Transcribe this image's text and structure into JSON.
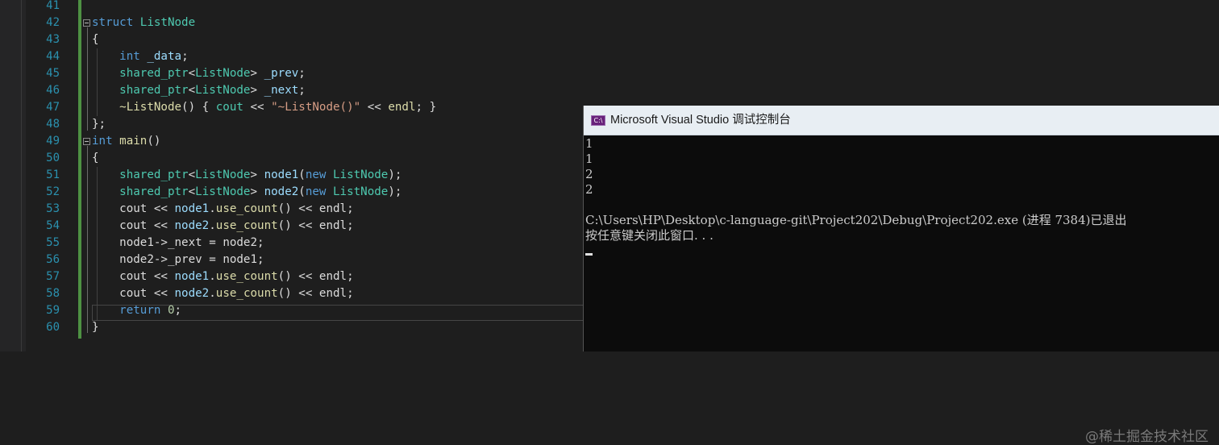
{
  "editor": {
    "line_numbers": [
      "41",
      "42",
      "43",
      "44",
      "45",
      "46",
      "47",
      "48",
      "49",
      "50",
      "51",
      "52",
      "53",
      "54",
      "55",
      "56",
      "57",
      "58",
      "59",
      "60"
    ],
    "lines": [
      {
        "indent": "",
        "tokens": []
      },
      {
        "indent": "",
        "tokens": [
          [
            "kw",
            "struct"
          ],
          [
            "pl",
            " "
          ],
          [
            "ty",
            "ListNode"
          ]
        ]
      },
      {
        "indent": "",
        "tokens": [
          [
            "pl",
            "{"
          ]
        ]
      },
      {
        "indent": "    ",
        "tokens": [
          [
            "kw",
            "int"
          ],
          [
            "pl",
            " "
          ],
          [
            "va",
            "_data"
          ],
          [
            "pl",
            ";"
          ]
        ]
      },
      {
        "indent": "    ",
        "tokens": [
          [
            "ty",
            "shared_ptr"
          ],
          [
            "pl",
            "<"
          ],
          [
            "ty",
            "ListNode"
          ],
          [
            "pl",
            "> "
          ],
          [
            "va",
            "_prev"
          ],
          [
            "pl",
            ";"
          ]
        ]
      },
      {
        "indent": "    ",
        "tokens": [
          [
            "ty",
            "shared_ptr"
          ],
          [
            "pl",
            "<"
          ],
          [
            "ty",
            "ListNode"
          ],
          [
            "pl",
            "> "
          ],
          [
            "va",
            "_next"
          ],
          [
            "pl",
            ";"
          ]
        ]
      },
      {
        "indent": "    ",
        "tokens": [
          [
            "fn",
            "~ListNode"
          ],
          [
            "pl",
            "() { "
          ],
          [
            "ty",
            "cout"
          ],
          [
            "pl",
            " << "
          ],
          [
            "st",
            "\"~ListNode()\""
          ],
          [
            "pl",
            " << "
          ],
          [
            "fn",
            "endl"
          ],
          [
            "pl",
            "; }"
          ]
        ]
      },
      {
        "indent": "",
        "tokens": [
          [
            "pl",
            "};"
          ]
        ]
      },
      {
        "indent": "",
        "tokens": [
          [
            "kw",
            "int"
          ],
          [
            "pl",
            " "
          ],
          [
            "fn",
            "main"
          ],
          [
            "pl",
            "()"
          ]
        ]
      },
      {
        "indent": "",
        "tokens": [
          [
            "pl",
            "{"
          ]
        ]
      },
      {
        "indent": "    ",
        "tokens": [
          [
            "ty",
            "shared_ptr"
          ],
          [
            "pl",
            "<"
          ],
          [
            "ty",
            "ListNode"
          ],
          [
            "pl",
            "> "
          ],
          [
            "lv",
            "node1"
          ],
          [
            "pl",
            "("
          ],
          [
            "kw",
            "new"
          ],
          [
            "pl",
            " "
          ],
          [
            "ty",
            "ListNode"
          ],
          [
            "pl",
            ");"
          ]
        ]
      },
      {
        "indent": "    ",
        "tokens": [
          [
            "ty",
            "shared_ptr"
          ],
          [
            "pl",
            "<"
          ],
          [
            "ty",
            "ListNode"
          ],
          [
            "pl",
            "> "
          ],
          [
            "lv",
            "node2"
          ],
          [
            "pl",
            "("
          ],
          [
            "kw",
            "new"
          ],
          [
            "pl",
            " "
          ],
          [
            "ty",
            "ListNode"
          ],
          [
            "pl",
            ");"
          ]
        ]
      },
      {
        "indent": "    ",
        "tokens": [
          [
            "pl",
            "cout << "
          ],
          [
            "lv",
            "node1"
          ],
          [
            "pl",
            "."
          ],
          [
            "me",
            "use_count"
          ],
          [
            "pl",
            "() << "
          ],
          [
            "pl",
            "endl;"
          ]
        ]
      },
      {
        "indent": "    ",
        "tokens": [
          [
            "pl",
            "cout << "
          ],
          [
            "lv",
            "node2"
          ],
          [
            "pl",
            "."
          ],
          [
            "me",
            "use_count"
          ],
          [
            "pl",
            "() << "
          ],
          [
            "pl",
            "endl;"
          ]
        ]
      },
      {
        "indent": "    ",
        "tokens": [
          [
            "pl",
            "node1->"
          ],
          [
            "pl",
            "_next = "
          ],
          [
            "pl",
            "node2;"
          ]
        ]
      },
      {
        "indent": "    ",
        "tokens": [
          [
            "pl",
            "node2->"
          ],
          [
            "pl",
            "_prev = "
          ],
          [
            "pl",
            "node1;"
          ]
        ]
      },
      {
        "indent": "    ",
        "tokens": [
          [
            "pl",
            "cout << "
          ],
          [
            "lv",
            "node1"
          ],
          [
            "pl",
            "."
          ],
          [
            "me",
            "use_count"
          ],
          [
            "pl",
            "() << "
          ],
          [
            "pl",
            "endl;"
          ]
        ]
      },
      {
        "indent": "    ",
        "tokens": [
          [
            "pl",
            "cout << "
          ],
          [
            "lv",
            "node2"
          ],
          [
            "pl",
            "."
          ],
          [
            "me",
            "use_count"
          ],
          [
            "pl",
            "() << "
          ],
          [
            "pl",
            "endl;"
          ]
        ]
      },
      {
        "indent": "    ",
        "tokens": [
          [
            "kw",
            "return"
          ],
          [
            "pl",
            " "
          ],
          [
            "nu",
            "0"
          ],
          [
            "pl",
            ";"
          ]
        ]
      },
      {
        "indent": "",
        "tokens": [
          [
            "pl",
            "}"
          ]
        ]
      }
    ]
  },
  "console": {
    "title": "Microsoft Visual Studio 调试控制台",
    "icon": "console-app-icon",
    "icon_glyph": "C:\\",
    "lines": [
      "1",
      "1",
      "2",
      "2",
      "",
      "C:\\Users\\HP\\Desktop\\c-language-git\\Project202\\Debug\\Project202.exe (进程 7384)已退出",
      "按任意键关闭此窗口. . ."
    ]
  },
  "watermark": "@稀土掘金技术社区"
}
